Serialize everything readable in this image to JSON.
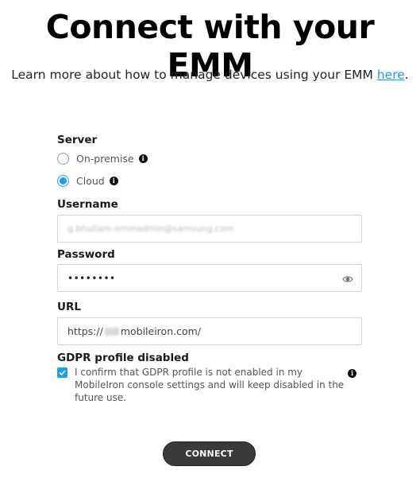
{
  "header": {
    "title": "Connect with your EMM",
    "subtitle_prefix": "Learn more about how to manage devices using your EMM ",
    "subtitle_link": "here",
    "subtitle_suffix": "."
  },
  "form": {
    "server": {
      "label": "Server",
      "options": [
        {
          "label": "On-premise",
          "selected": false
        },
        {
          "label": "Cloud",
          "selected": true
        }
      ]
    },
    "username": {
      "label": "Username",
      "value": "g.bhullam-emmadmin@samsung.com"
    },
    "password": {
      "label": "Password",
      "value": "••••••••"
    },
    "url": {
      "label": "URL",
      "value_prefix": "https://",
      "value_suffix": "mobileiron.com/"
    },
    "gdpr": {
      "label": "GDPR profile disabled",
      "checked": true,
      "text": "I confirm that GDPR profile is not enabled in my MobileIron console settings and will keep disabled in the future use."
    }
  },
  "actions": {
    "connect_label": "CONNECT"
  },
  "colors": {
    "accent": "#1a9cf0",
    "button_bg": "#3a3a3a"
  }
}
